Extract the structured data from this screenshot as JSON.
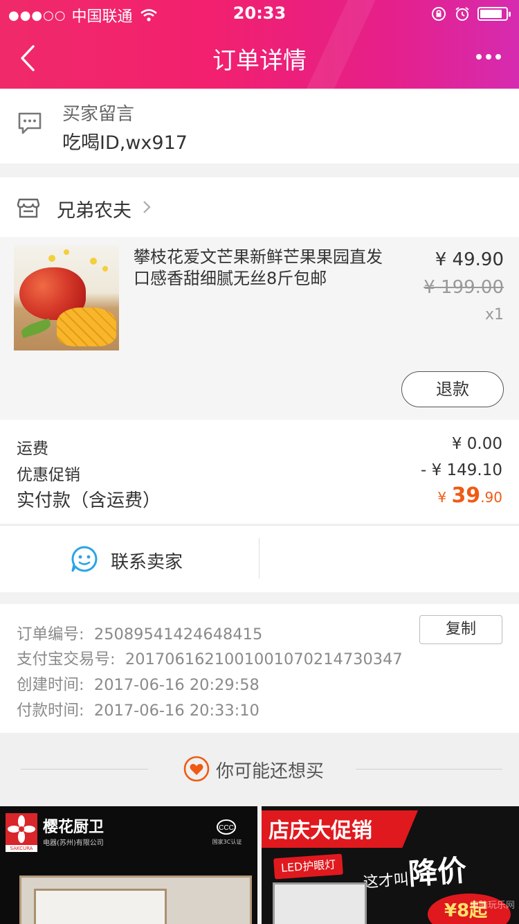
{
  "status_bar": {
    "signal": "●●●○○",
    "carrier": "中国联通",
    "time": "20:33",
    "battery_level": 0.85
  },
  "nav": {
    "title": "订单详情"
  },
  "buyer_message": {
    "label": "买家留言",
    "text": "吃喝ID,wx917"
  },
  "shop": {
    "name": "兄弟农夫"
  },
  "product": {
    "title": "攀枝花爱文芒果新鲜芒果果园直发口感香甜细腻无丝8斤包邮",
    "price": "¥ 49.90",
    "original_price": "¥ 199.00",
    "quantity": "x1",
    "refund_label": "退款"
  },
  "fees": {
    "shipping_label": "运费",
    "shipping_value": "¥ 0.00",
    "discount_label": "优惠促销",
    "discount_value": "- ¥ 149.10",
    "total_label": "实付款（含运费）",
    "total_currency": "¥",
    "total_integer": "39",
    "total_decimal": ".90"
  },
  "actions": {
    "contact_seller": "联系卖家"
  },
  "order_info": {
    "order_no_label": "订单编号:",
    "order_no": "25089541424648415",
    "alipay_label": "支付宝交易号:",
    "alipay_no": "2017061621001001070214730347",
    "created_label": "创建时间:",
    "created_time": "2017-06-16 20:29:58",
    "paid_label": "付款时间:",
    "paid_time": "2017-06-16 20:33:10",
    "copy_label": "复制"
  },
  "recommend": {
    "label": "你可能还想买",
    "tiles": [
      {
        "brand": "樱花厨卫",
        "brand_en": "SAKCURA",
        "company": "电器(苏州)有限公司",
        "cert": "国家3C认证"
      },
      {
        "headline": "店庆大促销",
        "tag": "LED护眼灯",
        "slogan_pre": "这才叫",
        "slogan_big": "降价",
        "price_text": "¥8起"
      }
    ],
    "watermark": "电脑玩乐网"
  },
  "colors": {
    "header_gradient_start": "#f02a6a",
    "header_gradient_end": "#d62bb0",
    "accent_orange": "#f05a14",
    "contact_blue": "#29a4e8",
    "promo_red": "#e0191f"
  },
  "icons": {
    "back": "chevron-left-icon",
    "more": "more-dots-icon",
    "message": "chat-bubble-icon",
    "shop": "shop-icon",
    "contact": "smiley-chat-icon",
    "recommend": "heart-icon"
  }
}
